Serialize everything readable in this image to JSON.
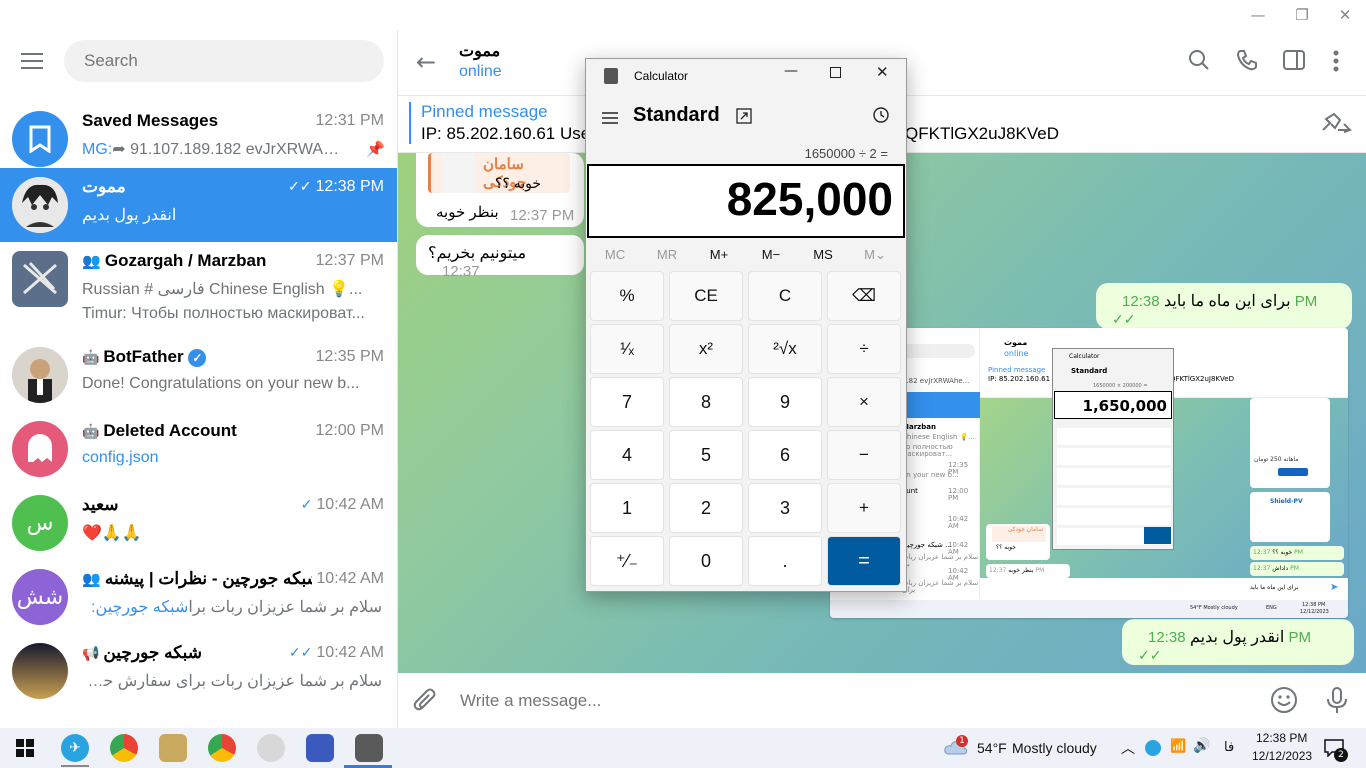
{
  "window": {
    "minimize": "—",
    "maximize": "❐",
    "close": "✕"
  },
  "sidebar": {
    "search_placeholder": "Search",
    "chats": [
      {
        "name": "Saved Messages",
        "time": "12:31 PM",
        "prefix": "MG:",
        "preview": "➦ 91.107.189.182 evJrXRWAhe...",
        "avatar_color": "#3390ec",
        "icon": "bookmark-icon"
      },
      {
        "name": "مموت",
        "time": "12:38 PM",
        "preview": "انقدر پول بدیم",
        "active": true
      },
      {
        "name": "Gozargah / Marzban",
        "time": "12:37 PM",
        "preview": "Russian # فارسی Chinese English 💡...",
        "preview2": "Timur: Чтобы полностью маскироват...",
        "avatar_color": "#5b6e8a"
      },
      {
        "name": "BotFather",
        "time": "12:35 PM",
        "preview": "Done! Congratulations on your new b...",
        "verified": true
      },
      {
        "name": "Deleted Account",
        "time": "12:00 PM",
        "preview": "config.json",
        "avatar_color": "#e5597a"
      },
      {
        "name": "سعید",
        "time": "10:42 AM",
        "preview": "❤️🙏🙏",
        "avatar_color": "#4fbf4f",
        "initials": "س"
      },
      {
        "name": "شبکه جورچین - نظرات | پیشنه...",
        "time": "10:42 AM",
        "preview": "سلام بر شما عزیزان   ربات برا",
        "prefix": "شبکه جورچین:",
        "avatar_color": "#8e63d6",
        "initials": "شش"
      },
      {
        "name": "شبکه جورچین",
        "time": "10:42 AM",
        "preview": "سلام بر شما عزیزان   ربات برای سفارش حساب آ"
      }
    ]
  },
  "chat": {
    "title": "مموت",
    "status": "online",
    "pinned_label": "Pinned message",
    "pinned_text": "IP: 85.202.160.61 User",
    "pinned_tail": "QFKTlGX2uJ8KVeD",
    "messages": [
      {
        "text": "سامان جودکی",
        "sub": "خوبه ؟؟"
      },
      {
        "text": "بنظر خوبه",
        "time": "12:37 PM"
      },
      {
        "text": "میتونیم بخریم؟",
        "time": "12:37"
      },
      {
        "text": "برای این ماه ما باید",
        "time": "12:38 PM"
      },
      {
        "text": "انقدر پول بدیم",
        "time": "12:38 PM"
      }
    ],
    "composer_placeholder": "Write a message..."
  },
  "calculator": {
    "title": "Calculator",
    "mode": "Standard",
    "expression": "1650000 ÷ 2 =",
    "display": "825,000",
    "memory": [
      "MC",
      "MR",
      "M+",
      "M−",
      "MS",
      "M⌄"
    ],
    "keys": [
      [
        "%",
        "CE",
        "C",
        "⌫"
      ],
      [
        "¹⁄ₓ",
        "x²",
        "²√x",
        "÷"
      ],
      [
        "7",
        "8",
        "9",
        "×"
      ],
      [
        "4",
        "5",
        "6",
        "−"
      ],
      [
        "1",
        "2",
        "3",
        "+"
      ],
      [
        "⁺⁄₋",
        "0",
        ".",
        "="
      ]
    ]
  },
  "screenshot": {
    "title": "مموت",
    "status": "online",
    "pinned_label": "Pinned message",
    "pinned_text": "IP: 85.202.160.61",
    "calc_title": "Calculator",
    "calc_mode": "Standard",
    "calc_expression": "1650000 × 200000 =",
    "calc_display": "1,650,000",
    "pinned_tail": "QFKTlGX2uJ8KVeD",
    "sidebar_lines": [
      ".182 evJrXRWAhe...",
      "Marzban",
      "Chinese  English 💡...",
      "то полностью маскироват...",
      "12:35 PM",
      "on your new b...",
      "12:00 PM",
      "ount",
      "10:42 AM",
      "10:42 AM",
      "شبکه جورچین ...",
      "سلام بر شما عزیزان ربات برا",
      "10:42 AM",
      "سلام بر شما عزیزان ربات برای"
    ],
    "bubble_name": "سامان جودکی",
    "bubble_sub": "خوبه ؟؟",
    "bubble_2": "بنظر خوبه",
    "bubble_3": "میتونیم بخریم؟",
    "bubble_right_1": "خوبه ؟؟",
    "bubble_right_2": "داداش",
    "bubble_right_3": "ماهانه 250 تومان",
    "bubble_right_4": "Shield-PV",
    "bubble_time": "12:37 PM",
    "composer": "برای این ماه ما باید",
    "taskbar_weather": "54°F  Mostly cloudy",
    "taskbar_lang": "ENG",
    "taskbar_time": "12:38 PM",
    "taskbar_date": "12/12/2023"
  },
  "taskbar": {
    "weather_temp": "54°F",
    "weather_desc": "Mostly cloudy",
    "weather_badge": "1",
    "lang": "فا",
    "time": "12:38 PM",
    "date": "12/12/2023",
    "notif_count": "2"
  }
}
